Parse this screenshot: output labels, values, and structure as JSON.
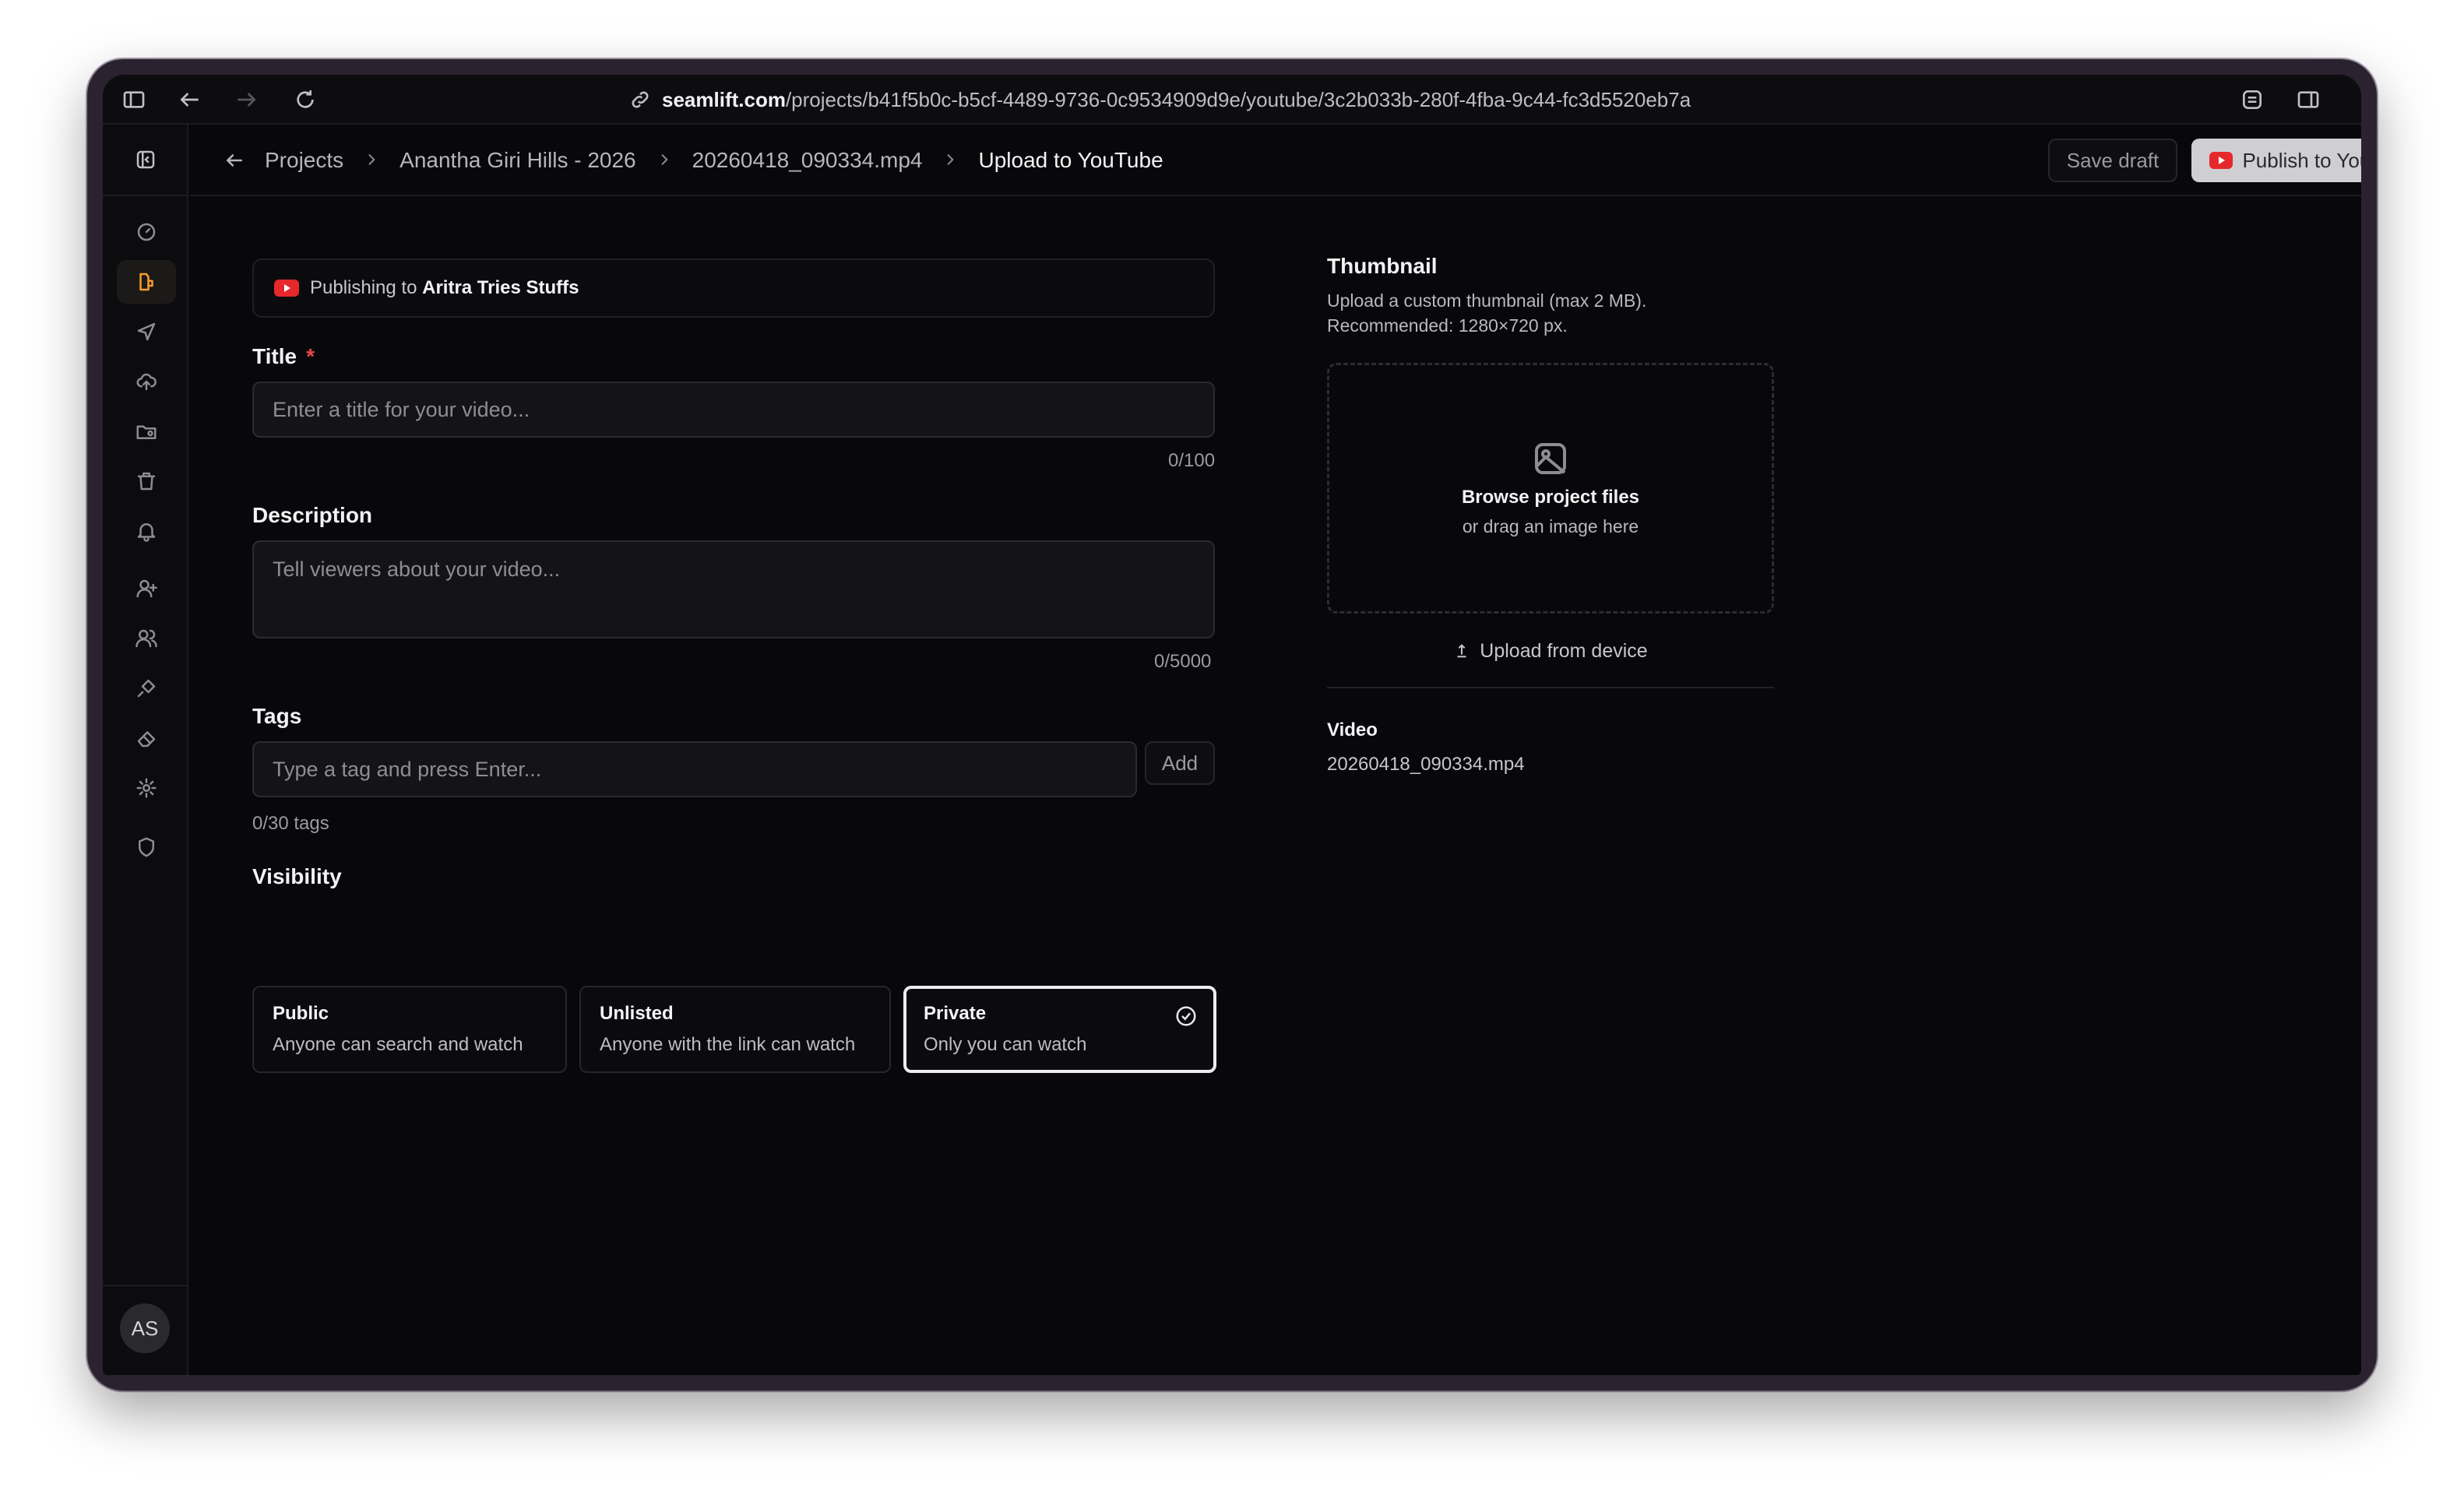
{
  "browser": {
    "url_host": "seamlift.com",
    "url_path": "/projects/b41f5b0c-b5cf-4489-9736-0c9534909d9e/youtube/3c2b033b-280f-4fba-9c44-fc3d5520eb7a"
  },
  "breadcrumb": {
    "items": [
      "Projects",
      "Anantha Giri Hills - 2026",
      "20260418_090334.mp4"
    ],
    "current": "Upload to YouTube"
  },
  "header_actions": {
    "save_draft": "Save draft",
    "publish": "Publish to YouTube"
  },
  "sidebar": {
    "items": [
      "dashboard",
      "projects",
      "send",
      "cloud-upload",
      "folder-shared",
      "trash",
      "notifications",
      "add-user",
      "team",
      "integrations",
      "labels",
      "settings",
      "security"
    ],
    "active": "projects",
    "avatar_initials": "AS"
  },
  "publishing": {
    "prefix": "Publishing to",
    "channel": "Aritra Tries Stuffs"
  },
  "form": {
    "title_label": "Title",
    "title_required_mark": "*",
    "title_placeholder": "Enter a title for your video...",
    "title_counter": "0/100",
    "description_label": "Description",
    "description_placeholder": "Tell viewers about your video...",
    "description_counter": "0/5000",
    "tags_label": "Tags",
    "tags_placeholder": "Type a tag and press Enter...",
    "tags_add": "Add",
    "tags_counter": "0/30 tags",
    "visibility_label": "Visibility",
    "visibility_options": [
      {
        "title": "Public",
        "desc": "Anyone can search and watch"
      },
      {
        "title": "Unlisted",
        "desc": "Anyone with the link can watch"
      },
      {
        "title": "Private",
        "desc": "Only you can watch"
      }
    ],
    "visibility_selected": "Private"
  },
  "thumbnail": {
    "title": "Thumbnail",
    "desc_line1": "Upload a custom thumbnail (max 2 MB).",
    "desc_line2": "Recommended: 1280×720 px.",
    "browse": "Browse project files",
    "drag": "or drag an image here",
    "upload_device": "Upload from device"
  },
  "video": {
    "label": "Video",
    "filename": "20260418_090334.mp4"
  },
  "colors": {
    "accent": "#f59e2a",
    "youtube_red": "#e5282b",
    "required": "#e5484d"
  }
}
